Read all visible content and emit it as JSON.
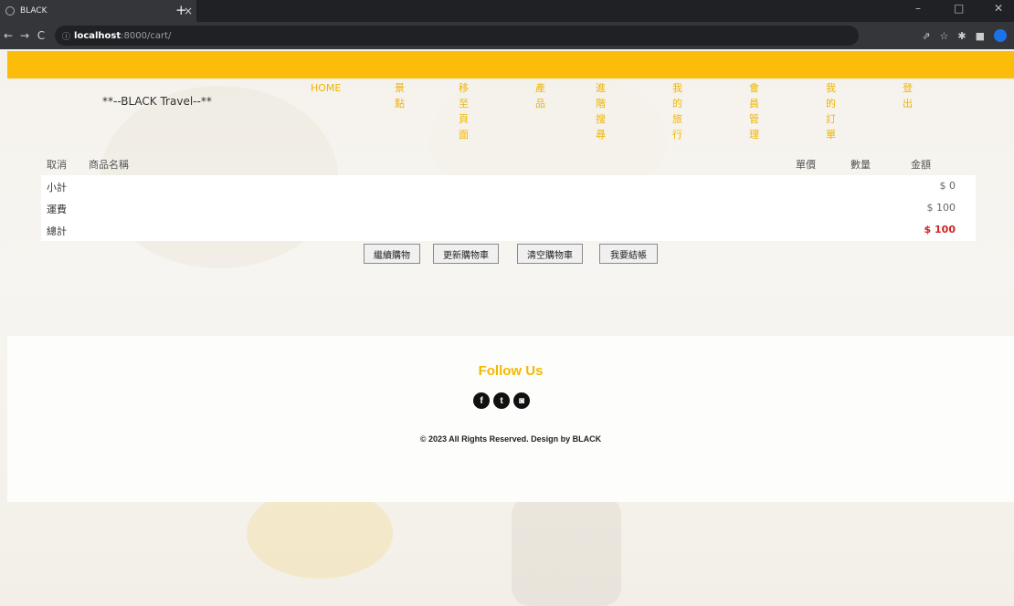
{
  "browser": {
    "tab_title": "BLACK",
    "tab_close": "×",
    "new_tab": "+",
    "url_host": "localhost",
    "url_path": ":8000/cart/",
    "lock_icon": "ⓘ",
    "back": "←",
    "forward": "→",
    "reload": "C",
    "minimize": "–",
    "maximize": "□",
    "close": "✕"
  },
  "site": {
    "brand": "**--BLACK Travel--**",
    "menu": [
      {
        "line1": "HOME",
        "line2": ""
      },
      {
        "line1": "景",
        "line2": "點"
      },
      {
        "line1": "移至",
        "line2": "頁面"
      },
      {
        "line1": "產",
        "line2": "品"
      },
      {
        "line1": "進階",
        "line2": "搜尋"
      },
      {
        "line1": "我的",
        "line2": "旅行"
      },
      {
        "line1": "會員",
        "line2": "管理"
      },
      {
        "line1": "我的",
        "line2": "訂單"
      },
      {
        "line1": "登",
        "line2": "出"
      }
    ]
  },
  "cart": {
    "headers": {
      "cancel": "取消",
      "product_name": "商品名稱",
      "unit_price": "單價",
      "quantity": "數量",
      "amount": "金額"
    },
    "rows": [
      {
        "label": "小計",
        "value": "$ 0"
      },
      {
        "label": "運費",
        "value": "$ 100"
      },
      {
        "label": "總計",
        "value": "$ 100"
      }
    ],
    "buttons": [
      "繼續購物",
      "更新購物車",
      "清空購物車",
      "我要結帳"
    ]
  },
  "footer": {
    "follow": "Follow Us",
    "social": [
      {
        "icon": "facebook-icon",
        "glyph": "f"
      },
      {
        "icon": "twitter-icon",
        "glyph": "t"
      },
      {
        "icon": "instagram-icon",
        "glyph": "◙"
      }
    ],
    "copyright": "© 2023 All Rights Reserved. Design by BLACK"
  },
  "colors": {
    "accent": "#fbbd0a",
    "total": "#d42222"
  }
}
